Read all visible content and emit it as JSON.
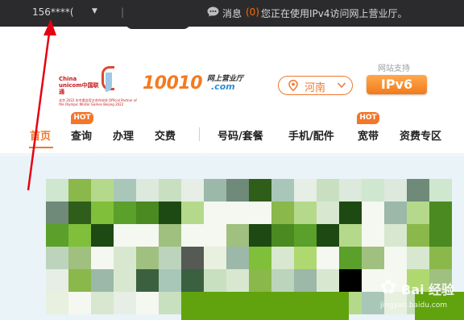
{
  "topbar": {
    "phone": "156****(",
    "message_label": "消息",
    "message_count": "(0)",
    "ip_notice": "您正在使用IPv4访问网上营业厅。",
    "separator": "|"
  },
  "header": {
    "logo_text": "China unicom中国联通",
    "logo_subtext": "北京 2022 年冬奥会官方合作伙伴 Official Partner of the Olympic Winter Games Beijing 2022",
    "brand_number": "10010",
    "brand_tagline": "网上营业厅",
    "brand_domain": ".com",
    "region": "河南",
    "ipv6_support": "网站支持",
    "ipv6_badge": "IPv6"
  },
  "nav": {
    "items": [
      {
        "label": "首页",
        "active": true
      },
      {
        "label": "查询",
        "hot": true
      },
      {
        "label": "办理"
      },
      {
        "label": "交费"
      },
      {
        "label": "号码/套餐"
      },
      {
        "label": "手机/配件"
      },
      {
        "label": "宽带",
        "hot": true
      },
      {
        "label": "资费专区"
      }
    ],
    "hot_label": "HOT"
  },
  "watermark": {
    "brand": "Bai 经验",
    "url": "jingyan.baidu.com"
  },
  "colors": {
    "topbar_bg": "#2b2b2d",
    "accent_orange": "#f3762b",
    "unicom_red": "#c4161c",
    "banner_green": "#61a30f"
  },
  "icons": [
    "chat-bubble-icon",
    "location-pin-icon",
    "chevron-down-icon",
    "caret-down-icon",
    "annotation-arrow-icon",
    "paw-icon"
  ]
}
